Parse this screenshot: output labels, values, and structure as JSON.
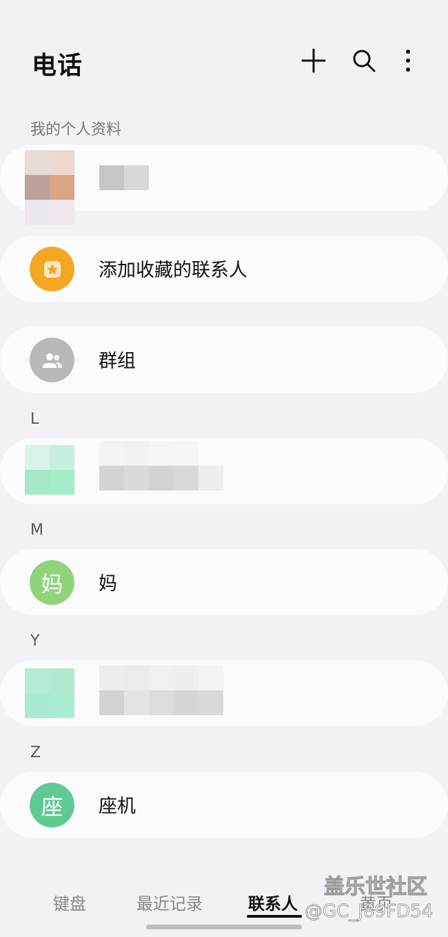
{
  "header": {
    "title": "电话",
    "icons": [
      "add-icon",
      "search-icon",
      "more-vertical-icon"
    ]
  },
  "profile": {
    "section_label": "我的个人资料"
  },
  "favorites": {
    "label": "添加收藏的联系人",
    "icon": "star-icon",
    "color": "#f5a623"
  },
  "groups": {
    "label": "群组",
    "icon": "group-icon",
    "color": "#b8b8bc"
  },
  "sections": [
    {
      "letter": "L"
    },
    {
      "letter": "M",
      "contact": {
        "avatar": "妈",
        "name": "妈",
        "color": "#8fd47a"
      }
    },
    {
      "letter": "Y"
    },
    {
      "letter": "Z",
      "contact": {
        "avatar": "座",
        "name": "座机",
        "color": "#5fcb93"
      }
    }
  ],
  "tabs": [
    {
      "label": "键盘"
    },
    {
      "label": "最近记录"
    },
    {
      "label": "联系人",
      "active": true
    },
    {
      "label": "黄页"
    }
  ],
  "watermark": {
    "line1": "盖乐世社区",
    "line2": "@GC_J89FD54"
  }
}
